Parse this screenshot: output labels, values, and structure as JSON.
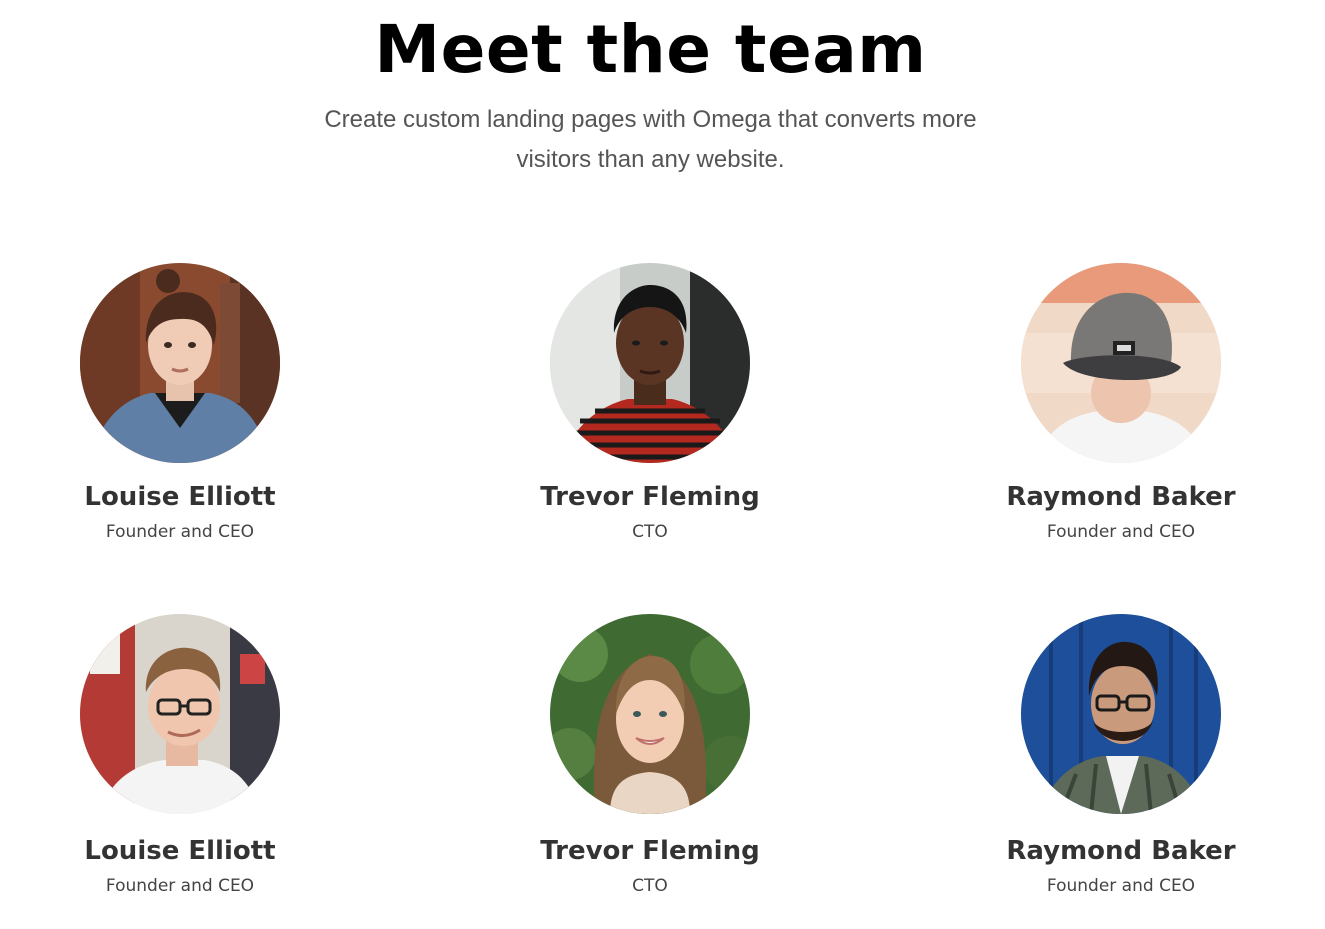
{
  "section": {
    "title": "Meet the team",
    "subtitle": "Create custom landing pages with Omega that converts more visitors than any website."
  },
  "members": [
    {
      "name": "Louise Elliott",
      "role": "Founder and CEO",
      "photo_icon": "portrait-woman-denim-jacket"
    },
    {
      "name": "Trevor Fleming",
      "role": "CTO",
      "photo_icon": "portrait-man-striped-shirt"
    },
    {
      "name": "Raymond Baker",
      "role": "Founder and CEO",
      "photo_icon": "portrait-man-gray-cap"
    },
    {
      "name": "Louise Elliott",
      "role": "Founder and CEO",
      "photo_icon": "portrait-man-glasses-white-shirt"
    },
    {
      "name": "Trevor Fleming",
      "role": "CTO",
      "photo_icon": "portrait-woman-smiling-greenery"
    },
    {
      "name": "Raymond Baker",
      "role": "Founder and CEO",
      "photo_icon": "portrait-man-beard-blue-wall"
    }
  ],
  "colors": {
    "title": "#000000",
    "subtitle": "#555555",
    "name": "#333333",
    "role": "#444444",
    "background": "#ffffff"
  }
}
